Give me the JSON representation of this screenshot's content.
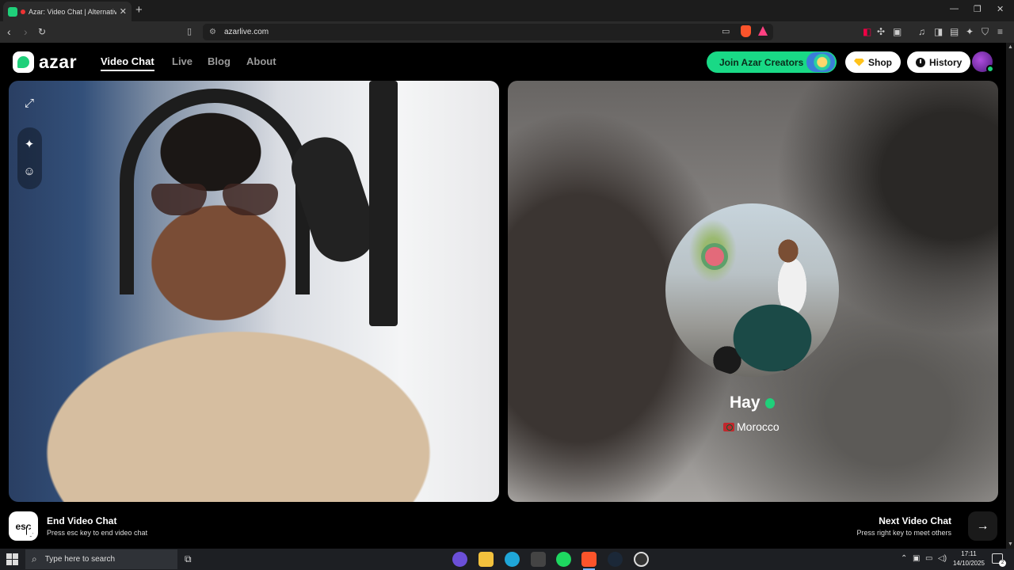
{
  "browser": {
    "tab_title": "Azar: Video Chat | Alternative",
    "tab_close": "✕",
    "new_tab": "+",
    "url": "azarlive.com",
    "win_min": "—",
    "win_max": "❐",
    "win_close": "✕"
  },
  "site": {
    "logo_text": "azar",
    "nav": [
      "Video Chat",
      "Live",
      "Blog",
      "About"
    ],
    "join_creators": "Join Azar Creators",
    "shop": "Shop",
    "history": "History",
    "brand_color": "#1fd07a"
  },
  "partner": {
    "name": "Hay",
    "country": "Morocco"
  },
  "controls": {
    "esc_key": "esc",
    "end_title": "End Video Chat",
    "end_sub": "Press esc key to end video chat",
    "next_title": "Next Video Chat",
    "next_sub": "Press right key to meet others",
    "next_arrow": "→"
  },
  "taskbar": {
    "search_placeholder": "Type here to search",
    "time": "17:11",
    "date": "14/10/2025",
    "notification_count": "2"
  }
}
